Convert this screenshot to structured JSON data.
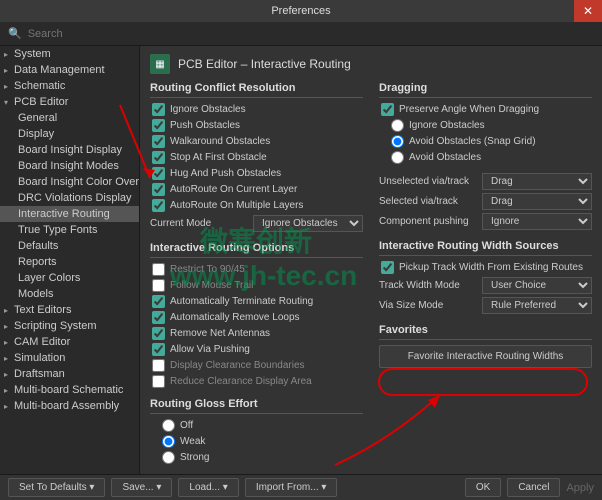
{
  "window": {
    "title": "Preferences"
  },
  "search": {
    "placeholder": "Search"
  },
  "sidebar": {
    "items": [
      {
        "label": "System",
        "exp": true,
        "top": true
      },
      {
        "label": "Data Management",
        "exp": true,
        "top": true
      },
      {
        "label": "Schematic",
        "exp": true,
        "top": true
      },
      {
        "label": "PCB Editor",
        "exp": false,
        "top": true
      },
      {
        "label": "General",
        "sub": true
      },
      {
        "label": "Display",
        "sub": true
      },
      {
        "label": "Board Insight Display",
        "sub": true
      },
      {
        "label": "Board Insight Modes",
        "sub": true
      },
      {
        "label": "Board Insight Color Overrides",
        "sub": true
      },
      {
        "label": "DRC Violations Display",
        "sub": true
      },
      {
        "label": "Interactive Routing",
        "sub": true,
        "selected": true
      },
      {
        "label": "True Type Fonts",
        "sub": true
      },
      {
        "label": "Defaults",
        "sub": true
      },
      {
        "label": "Reports",
        "sub": true
      },
      {
        "label": "Layer Colors",
        "sub": true
      },
      {
        "label": "Models",
        "sub": true
      },
      {
        "label": "Text Editors",
        "exp": true,
        "top": true
      },
      {
        "label": "Scripting System",
        "exp": true,
        "top": true
      },
      {
        "label": "CAM Editor",
        "exp": true,
        "top": true
      },
      {
        "label": "Simulation",
        "exp": true,
        "top": true
      },
      {
        "label": "Draftsman",
        "exp": true,
        "top": true
      },
      {
        "label": "Multi-board Schematic",
        "exp": true,
        "top": true
      },
      {
        "label": "Multi-board Assembly",
        "exp": true,
        "top": true
      }
    ]
  },
  "main": {
    "title": "PCB Editor – Interactive Routing",
    "conflict": {
      "title": "Routing Conflict Resolution",
      "items": [
        {
          "label": "Ignore Obstacles",
          "checked": true
        },
        {
          "label": "Push Obstacles",
          "checked": true
        },
        {
          "label": "Walkaround Obstacles",
          "checked": true
        },
        {
          "label": "Stop At First Obstacle",
          "checked": true
        },
        {
          "label": "Hug And Push Obstacles",
          "checked": true
        },
        {
          "label": "AutoRoute On Current Layer",
          "checked": true
        },
        {
          "label": "AutoRoute On Multiple Layers",
          "checked": true
        }
      ],
      "modeLabel": "Current Mode",
      "modeValue": "Ignore Obstacles"
    },
    "options": {
      "title": "Interactive Routing Options",
      "items": [
        {
          "label": "Restrict To 90/45",
          "checked": false,
          "dim": true
        },
        {
          "label": "Follow Mouse Trail",
          "checked": false,
          "dim": true
        },
        {
          "label": "Automatically Terminate Routing",
          "checked": true
        },
        {
          "label": "Automatically Remove Loops",
          "checked": true
        },
        {
          "label": "Remove Net Antennas",
          "checked": true
        },
        {
          "label": "Allow Via Pushing",
          "checked": true
        },
        {
          "label": "Display Clearance Boundaries",
          "checked": false,
          "dim": true
        },
        {
          "label": "Reduce Clearance Display Area",
          "checked": false,
          "dim": true
        }
      ]
    },
    "gloss": {
      "title": "Routing Gloss Effort",
      "items": [
        {
          "label": "Off",
          "checked": false
        },
        {
          "label": "Weak",
          "checked": true
        },
        {
          "label": "Strong",
          "checked": false
        }
      ]
    },
    "dragging": {
      "title": "Dragging",
      "preserve": {
        "label": "Preserve Angle When Dragging",
        "checked": true
      },
      "radios": [
        {
          "label": "Ignore Obstacles",
          "checked": false
        },
        {
          "label": "Avoid Obstacles (Snap Grid)",
          "checked": true
        },
        {
          "label": "Avoid Obstacles",
          "checked": false
        }
      ],
      "rows": [
        {
          "label": "Unselected via/track",
          "value": "Drag"
        },
        {
          "label": "Selected via/track",
          "value": "Drag"
        },
        {
          "label": "Component pushing",
          "value": "Ignore"
        }
      ]
    },
    "widthSources": {
      "title": "Interactive Routing Width Sources",
      "pickup": {
        "label": "Pickup Track Width From Existing Routes",
        "checked": true
      },
      "rows": [
        {
          "label": "Track Width Mode",
          "value": "User Choice"
        },
        {
          "label": "Via Size Mode",
          "value": "Rule Preferred"
        }
      ]
    },
    "favorites": {
      "title": "Favorites",
      "button": "Favorite Interactive Routing Widths"
    }
  },
  "footer": {
    "defaults": "Set To Defaults",
    "save": "Save...",
    "load": "Load...",
    "import": "Import From...",
    "ok": "OK",
    "cancel": "Cancel",
    "apply": "Apply"
  },
  "watermark": {
    "line1": "微寒创新",
    "line2": "www.jh-tec.cn"
  }
}
